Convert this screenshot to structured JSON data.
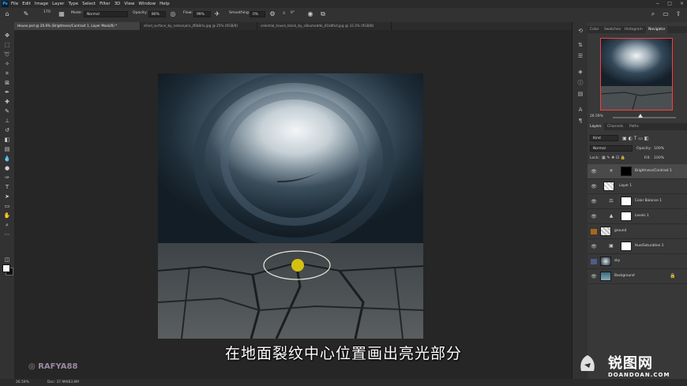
{
  "menubar": {
    "logo": "Ps",
    "items": [
      "File",
      "Edit",
      "Image",
      "Layer",
      "Type",
      "Select",
      "Filter",
      "3D",
      "View",
      "Window",
      "Help"
    ],
    "controls": [
      "−",
      "□",
      "×"
    ]
  },
  "options": {
    "size": "170",
    "mode_label": "Mode:",
    "mode_value": "Normal",
    "opacity_label": "Opacity:",
    "opacity_value": "80%",
    "flow_label": "Flow:",
    "flow_value": "99%",
    "smoothing_label": "Smoothing:",
    "smoothing_value": "0%",
    "angle_value": "0°"
  },
  "tabs": [
    "House.psd @ 26.6% (Brightness/Contrast 1, Layer Mask/8) *",
    "dried_surface_by_nelsonjaro_jf6b8rlo.jpg @ 25% (RGB/8)",
    "celestial_house_block_by_silkumoddo_d1k8fxd.jpg @ 33.3% (RGB/8)"
  ],
  "status": {
    "zoom": "26.59%",
    "doc": "Doc: 37.9M/83.6M"
  },
  "panels": {
    "top_tabs": [
      "Color",
      "Swatches",
      "Histogram",
      "Navigator"
    ],
    "nav_zoom": "26.59%",
    "layer_tabs": [
      "Layers",
      "Channels",
      "Paths"
    ],
    "kind": "Kind",
    "blend": "Normal",
    "opacity_label": "Opacity:",
    "opacity_value": "100%",
    "lock_label": "Lock:",
    "fill_label": "Fill:",
    "fill_value": "100%",
    "layers": [
      {
        "name": "Brightness/Contrast 1",
        "type": "adj",
        "icon": "☀"
      },
      {
        "name": "Layer 1",
        "type": "pixel"
      },
      {
        "name": "Color Balance 1",
        "type": "adj",
        "icon": "⚖"
      },
      {
        "name": "Levels 1",
        "type": "adj",
        "icon": "▲"
      },
      {
        "name": "ground",
        "type": "pixel"
      },
      {
        "name": "Hue/Saturation 1",
        "type": "adj",
        "icon": "▣"
      },
      {
        "name": "sky",
        "type": "pixel"
      },
      {
        "name": "Background",
        "type": "pixel"
      }
    ]
  },
  "subtitle": "在地面裂纹中心位置画出亮光部分",
  "watermark": {
    "user": "RAFYA88",
    "brand_cn": "锐图网",
    "brand_en": "DOANDOAN.COM"
  },
  "colors": {
    "accent": "#31a8ff",
    "nav_frame": "#ff3b3b",
    "brush_yellow": "#d4c10e"
  }
}
